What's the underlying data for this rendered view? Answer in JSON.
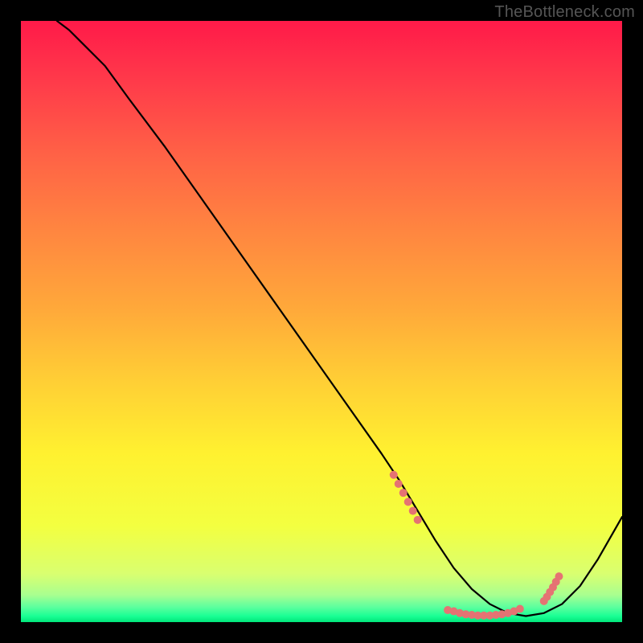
{
  "watermark": "TheBottleneck.com",
  "gradient": {
    "stops": [
      {
        "offset": 0.0,
        "color": "#ff1a49"
      },
      {
        "offset": 0.1,
        "color": "#ff3a4a"
      },
      {
        "offset": 0.22,
        "color": "#ff6146"
      },
      {
        "offset": 0.35,
        "color": "#ff8640"
      },
      {
        "offset": 0.48,
        "color": "#ffa93a"
      },
      {
        "offset": 0.6,
        "color": "#ffcf35"
      },
      {
        "offset": 0.72,
        "color": "#fff130"
      },
      {
        "offset": 0.84,
        "color": "#f3ff40"
      },
      {
        "offset": 0.92,
        "color": "#d9ff70"
      },
      {
        "offset": 0.955,
        "color": "#a8ff90"
      },
      {
        "offset": 0.975,
        "color": "#5cff9e"
      },
      {
        "offset": 0.99,
        "color": "#1aff94"
      },
      {
        "offset": 1.0,
        "color": "#00e67a"
      }
    ]
  },
  "chart_data": {
    "type": "line",
    "title": "",
    "xlabel": "",
    "ylabel": "",
    "xlim": [
      0,
      100
    ],
    "ylim": [
      0,
      100
    ],
    "series": [
      {
        "name": "bottleneck-curve",
        "x": [
          6,
          8,
          10,
          14,
          18,
          24,
          30,
          36,
          42,
          48,
          54,
          60,
          63,
          66,
          69,
          72,
          75,
          78,
          81,
          84,
          87,
          90,
          93,
          96,
          100
        ],
        "y": [
          100,
          98.5,
          96.5,
          92.5,
          87,
          79,
          70.5,
          62,
          53.5,
          45,
          36.5,
          28,
          23.5,
          18.5,
          13.5,
          9,
          5.5,
          3,
          1.5,
          1,
          1.5,
          3,
          6,
          10.5,
          17.5
        ]
      }
    ],
    "markers": {
      "name": "highlighted-region",
      "points": [
        {
          "x": 62.0,
          "y": 24.5
        },
        {
          "x": 62.8,
          "y": 23.0
        },
        {
          "x": 63.6,
          "y": 21.5
        },
        {
          "x": 64.4,
          "y": 20.0
        },
        {
          "x": 65.2,
          "y": 18.5
        },
        {
          "x": 66.0,
          "y": 17.0
        },
        {
          "x": 71.0,
          "y": 2.0
        },
        {
          "x": 72.0,
          "y": 1.8
        },
        {
          "x": 73.0,
          "y": 1.5
        },
        {
          "x": 74.0,
          "y": 1.3
        },
        {
          "x": 75.0,
          "y": 1.2
        },
        {
          "x": 76.0,
          "y": 1.1
        },
        {
          "x": 77.0,
          "y": 1.1
        },
        {
          "x": 78.0,
          "y": 1.1
        },
        {
          "x": 79.0,
          "y": 1.2
        },
        {
          "x": 80.0,
          "y": 1.3
        },
        {
          "x": 81.0,
          "y": 1.5
        },
        {
          "x": 82.0,
          "y": 1.8
        },
        {
          "x": 83.0,
          "y": 2.2
        },
        {
          "x": 87.0,
          "y": 3.5
        },
        {
          "x": 87.5,
          "y": 4.2
        },
        {
          "x": 88.0,
          "y": 5.0
        },
        {
          "x": 88.5,
          "y": 5.8
        },
        {
          "x": 89.0,
          "y": 6.7
        },
        {
          "x": 89.5,
          "y": 7.6
        }
      ],
      "radius": 5
    }
  }
}
